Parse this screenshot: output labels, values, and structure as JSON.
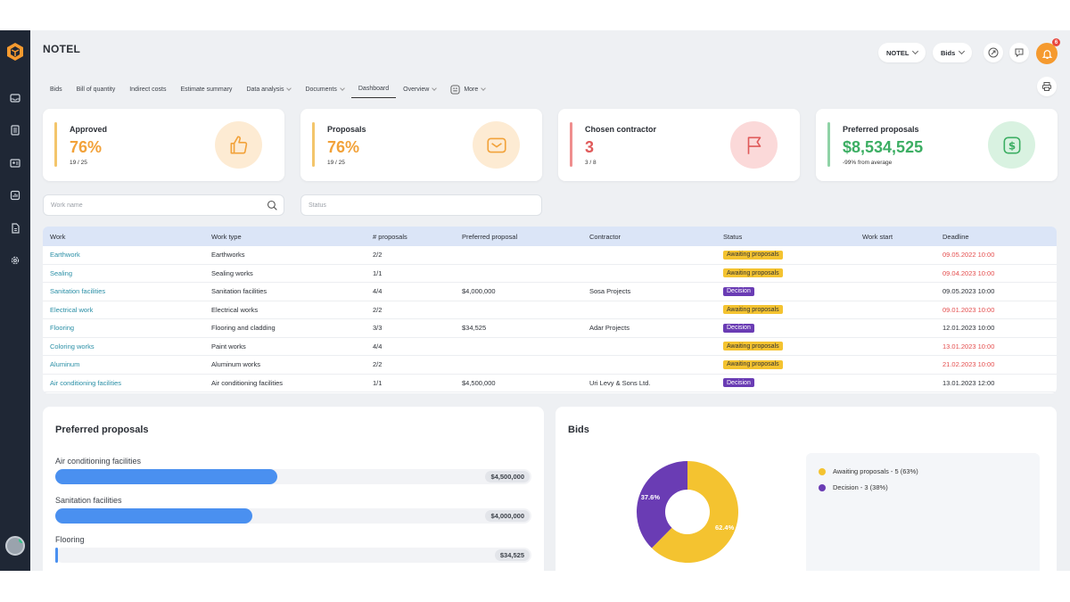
{
  "header": {
    "project": "NOTEL",
    "project_select": "NOTEL",
    "module_select": "Bids",
    "notifications_count": "6"
  },
  "tabs": [
    {
      "label": "Bids"
    },
    {
      "label": "Bill of quantity"
    },
    {
      "label": "Indirect costs"
    },
    {
      "label": "Estimate summary"
    },
    {
      "label": "Data analysis"
    },
    {
      "label": "Documents"
    },
    {
      "label": "Dashboard"
    },
    {
      "label": "Overview"
    },
    {
      "label": "More"
    }
  ],
  "cards": {
    "approved": {
      "title": "Approved",
      "value": "76%",
      "sub": "19 / 25",
      "color": "#f2a23a"
    },
    "proposals": {
      "title": "Proposals",
      "value": "76%",
      "sub": "19 / 25",
      "color": "#f2a23a"
    },
    "chosen": {
      "title": "Chosen contractor",
      "value": "3",
      "sub": "3 / 8",
      "color": "#e05a5a"
    },
    "preferred": {
      "title": "Preferred proposals",
      "value": "$8,534,525",
      "sub": "-99%  from average",
      "color": "#3cae63"
    }
  },
  "filters": {
    "work_placeholder": "Work name",
    "status_placeholder": "Status"
  },
  "table": {
    "headers": {
      "work": "Work",
      "type": "Work type",
      "proposals": "# proposals",
      "preferred": "Preferred proposal",
      "contractor": "Contractor",
      "status": "Status",
      "start": "Work start",
      "deadline": "Deadline"
    },
    "rows": [
      {
        "work": "Earthwork",
        "type": "Earthworks",
        "proposals": "2/2",
        "preferred": "",
        "contractor": "",
        "status": "Awaiting proposals",
        "start": "",
        "deadline": "09.05.2022 10:00",
        "late": true
      },
      {
        "work": "Sealing",
        "type": "Sealing works",
        "proposals": "1/1",
        "preferred": "",
        "contractor": "",
        "status": "Awaiting proposals",
        "start": "",
        "deadline": "09.04.2023 10:00",
        "late": true
      },
      {
        "work": "Sanitation facilities",
        "type": "Sanitation facilities",
        "proposals": "4/4",
        "preferred": "$4,000,000",
        "contractor": "Sosa Projects",
        "status": "Decision",
        "start": "",
        "deadline": "09.05.2023 10:00",
        "late": false
      },
      {
        "work": "Electrical work",
        "type": "Electrical works",
        "proposals": "2/2",
        "preferred": "",
        "contractor": "",
        "status": "Awaiting proposals",
        "start": "",
        "deadline": "09.01.2023 10:00",
        "late": true
      },
      {
        "work": "Flooring",
        "type": "Flooring and cladding",
        "proposals": "3/3",
        "preferred": "$34,525",
        "contractor": "Adar Projects",
        "status": "Decision",
        "start": "",
        "deadline": "12.01.2023 10:00",
        "late": false
      },
      {
        "work": "Coloring works",
        "type": "Paint works",
        "proposals": "4/4",
        "preferred": "",
        "contractor": "",
        "status": "Awaiting proposals",
        "start": "",
        "deadline": "13.01.2023 10:00",
        "late": true
      },
      {
        "work": "Aluminum",
        "type": "Aluminum works",
        "proposals": "2/2",
        "preferred": "",
        "contractor": "",
        "status": "Awaiting proposals",
        "start": "",
        "deadline": "21.02.2023 10:00",
        "late": true
      },
      {
        "work": "Air conditioning facilities",
        "type": "Air conditioning facilities",
        "proposals": "1/1",
        "preferred": "$4,500,000",
        "contractor": "Uri Levy & Sons Ltd.",
        "status": "Decision",
        "start": "",
        "deadline": "13.01.2023 12:00",
        "late": false
      }
    ]
  },
  "preferred_panel": {
    "title": "Preferred proposals",
    "items": [
      {
        "label": "Air conditioning facilities",
        "value": "$4,500,000",
        "amount": 4500000
      },
      {
        "label": "Sanitation facilities",
        "value": "$4,000,000",
        "amount": 4000000
      },
      {
        "label": "Flooring",
        "value": "$34,525",
        "amount": 34525
      }
    ],
    "bar_color": "#4a90f0"
  },
  "bids_panel": {
    "title": "Bids",
    "legend": [
      {
        "label": "Awaiting proposals - 5 (63%)",
        "color": "#f4c330"
      },
      {
        "label": "Decision - 3 (38%)",
        "color": "#6a3cb4"
      }
    ]
  },
  "chart_data": {
    "type": "pie",
    "categories": [
      "Awaiting proposals",
      "Decision"
    ],
    "values": [
      62.4,
      37.6
    ],
    "data_labels": [
      "62.4%",
      "37.6%"
    ],
    "colors": [
      "#f4c330",
      "#6a3cb4"
    ]
  }
}
